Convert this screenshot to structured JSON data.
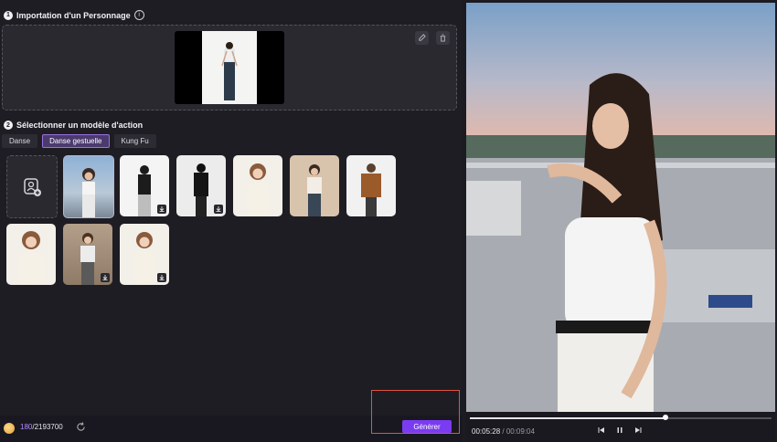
{
  "step1": {
    "number": "1",
    "title": "Importation d'un Personnage",
    "info_icon": "info-icon"
  },
  "step2": {
    "number": "2",
    "title": "Sélectionner un modèle d'action"
  },
  "tabs": [
    {
      "label": "Danse",
      "active": false
    },
    {
      "label": "Danse gestuelle",
      "active": true
    },
    {
      "label": "Kung Fu",
      "active": false
    }
  ],
  "templates": [
    {
      "name": "template-1",
      "selected": true,
      "downloadable": false
    },
    {
      "name": "template-2",
      "selected": false,
      "downloadable": true
    },
    {
      "name": "template-3",
      "selected": false,
      "downloadable": true
    },
    {
      "name": "template-4",
      "selected": false,
      "downloadable": false
    },
    {
      "name": "template-5",
      "selected": false,
      "downloadable": false
    },
    {
      "name": "template-6",
      "selected": false,
      "downloadable": false
    },
    {
      "name": "template-7",
      "selected": false,
      "downloadable": false
    },
    {
      "name": "template-8",
      "selected": false,
      "downloadable": true
    },
    {
      "name": "template-9",
      "selected": false,
      "downloadable": true
    }
  ],
  "footer": {
    "credits_current": "180",
    "credits_separator": "/",
    "credits_total": "2193700",
    "generate_label": "Générer"
  },
  "player": {
    "current_time": "00:05:28",
    "separator": " / ",
    "total_time": "00:09:04",
    "progress": 0.65
  },
  "colors": {
    "accent": "#7a3cf0",
    "highlight": "#e2533f",
    "active_tab": "#9a72e0"
  }
}
